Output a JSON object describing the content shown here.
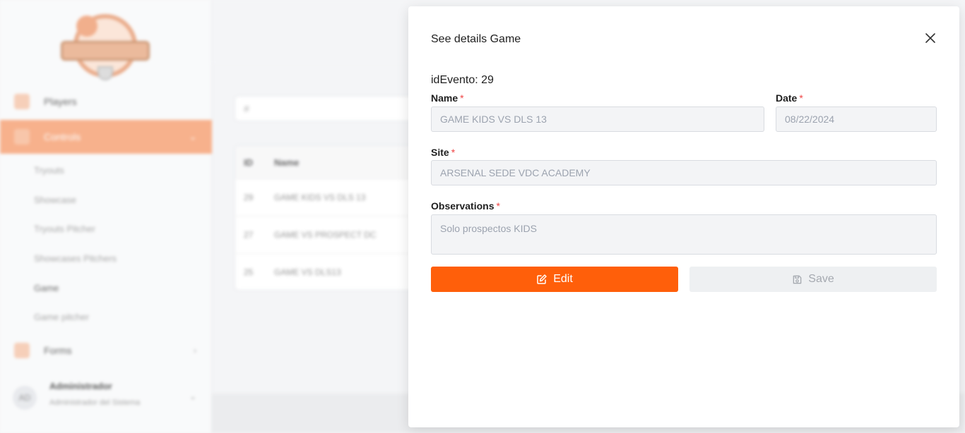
{
  "sidebar": {
    "items": [
      {
        "label": "Players"
      },
      {
        "label": "Controls"
      },
      {
        "label": "Forms"
      }
    ],
    "sub_items": [
      {
        "label": "Tryouts"
      },
      {
        "label": "Showcase"
      },
      {
        "label": "Tryouts Pitcher"
      },
      {
        "label": "Showcases Pitchers"
      },
      {
        "label": "Game"
      },
      {
        "label": "Game pitcher"
      }
    ],
    "user": {
      "initials": "AD",
      "name": "Administrador",
      "role": "Administrador del Sistema"
    }
  },
  "main": {
    "search_placeholder": "#",
    "table": {
      "columns": [
        "ID",
        "Name"
      ],
      "rows": [
        {
          "id": "29",
          "name": "GAME KIDS VS DLS 13"
        },
        {
          "id": "27",
          "name": "GAME VS PROSPECT DC"
        },
        {
          "id": "25",
          "name": "GAME VS DLS13"
        }
      ]
    }
  },
  "modal": {
    "title": "See details Game",
    "id_label": "idEvento: 29",
    "required_mark": "*",
    "name_label": "Name",
    "name_value": "GAME KIDS VS DLS 13",
    "date_label": "Date",
    "date_value": "08/22/2024",
    "site_label": "Site",
    "site_value": "ARSENAL SEDE VDC ACADEMY",
    "observations_label": "Observations",
    "observations_value": "Solo prospectos KIDS",
    "edit_label": "Edit",
    "save_label": "Save"
  },
  "colors": {
    "accent": "#ff5f0a",
    "required": "#ef4444"
  }
}
